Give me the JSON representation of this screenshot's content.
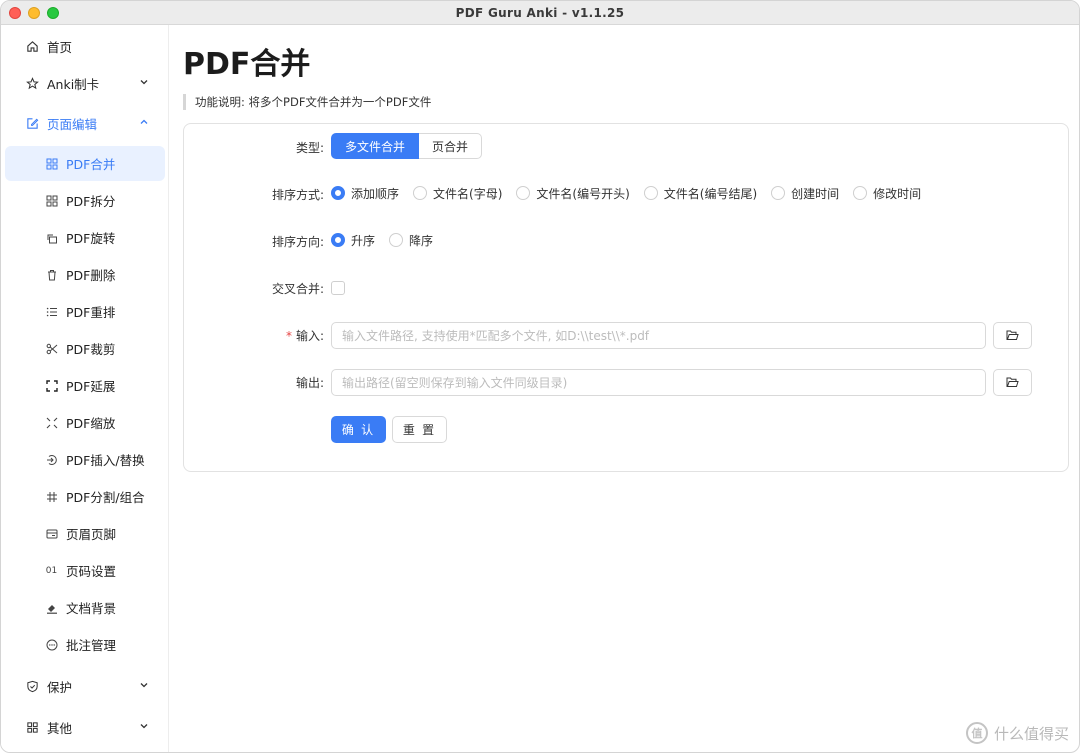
{
  "window": {
    "title": "PDF Guru Anki - v1.1.25"
  },
  "sidebar": {
    "items": [
      {
        "label": "首页",
        "icon": "home-icon"
      },
      {
        "label": "Anki制卡",
        "icon": "star-icon"
      },
      {
        "label": "页面编辑",
        "icon": "edit-icon"
      },
      {
        "label": "保护",
        "icon": "shield-icon"
      },
      {
        "label": "其他",
        "icon": "grid-icon"
      }
    ],
    "sub_items": [
      {
        "label": "PDF合并",
        "icon": "merge-icon"
      },
      {
        "label": "PDF拆分",
        "icon": "split-icon"
      },
      {
        "label": "PDF旋转",
        "icon": "rotate-icon"
      },
      {
        "label": "PDF删除",
        "icon": "trash-icon"
      },
      {
        "label": "PDF重排",
        "icon": "list-icon"
      },
      {
        "label": "PDF裁剪",
        "icon": "scissors-icon"
      },
      {
        "label": "PDF延展",
        "icon": "expand-icon"
      },
      {
        "label": "PDF缩放",
        "icon": "shrink-icon"
      },
      {
        "label": "PDF插入/替换",
        "icon": "insert-icon"
      },
      {
        "label": "PDF分割/组合",
        "icon": "hash-icon"
      },
      {
        "label": "页眉页脚",
        "icon": "header-footer-icon"
      },
      {
        "label": "页码设置",
        "icon_text": "01",
        "icon": "page-number-icon"
      },
      {
        "label": "文档背景",
        "icon": "background-icon"
      },
      {
        "label": "批注管理",
        "icon": "comment-icon"
      }
    ]
  },
  "main": {
    "title": "PDF合并",
    "description": "功能说明: 将多个PDF文件合并为一个PDF文件",
    "form": {
      "type_label": "类型:",
      "type_options": [
        "多文件合并",
        "页合并"
      ],
      "sort_method_label": "排序方式:",
      "sort_methods": [
        "添加顺序",
        "文件名(字母)",
        "文件名(编号开头)",
        "文件名(编号结尾)",
        "创建时间",
        "修改时间"
      ],
      "sort_direction_label": "排序方向:",
      "sort_directions": [
        "升序",
        "降序"
      ],
      "cross_merge_label": "交叉合并:",
      "input_required_mark": "*",
      "input_label": "输入:",
      "input_placeholder": "输入文件路径, 支持使用*匹配多个文件, 如D:\\\\test\\\\*.pdf",
      "output_label": "输出:",
      "output_placeholder": "输出路径(留空则保存到输入文件同级目录)",
      "confirm_label": "确 认",
      "reset_label": "重 置"
    }
  },
  "watermark": {
    "logo_text": "值",
    "text": "什么值得买"
  },
  "colors": {
    "accent": "#3a7cf5",
    "active_bg": "#e9f1ff"
  }
}
